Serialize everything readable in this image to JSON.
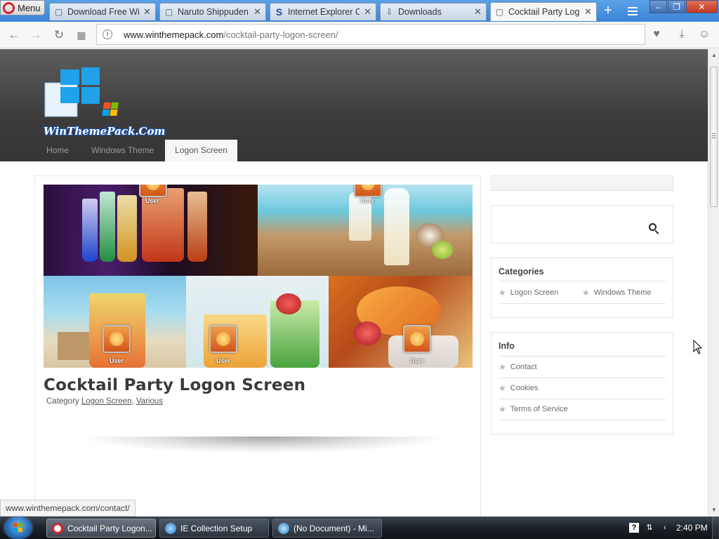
{
  "browser": {
    "menu_label": "Menu",
    "tabs": [
      {
        "title": "Download Free Windows",
        "icon": "page-icon"
      },
      {
        "title": "Naruto Shippuden",
        "icon": "page-icon"
      },
      {
        "title": "Internet Explorer Co",
        "icon": "s-logo-icon"
      },
      {
        "title": "Downloads",
        "icon": "download-icon"
      },
      {
        "title": "Cocktail Party Logon Screen",
        "icon": "page-icon",
        "active": true
      }
    ],
    "url_domain": "www.winthemepack.com",
    "url_path": "/cocktail-party-logon-screen/",
    "status_url": "www.winthemepack.com/contact/"
  },
  "site": {
    "logo_text": "WinThemePack.Com",
    "nav": [
      "Home",
      "Windows Theme",
      "Logon Screen"
    ],
    "nav_current": "Logon Screen"
  },
  "post": {
    "title": "Cocktail Party Logon Screen",
    "meta_prefix": "Category ",
    "categories": [
      "Logon Screen",
      "Various"
    ],
    "meta_sep": ", ",
    "tile_user_label": "User"
  },
  "sidebar": {
    "categories_title": "Categories",
    "categories": [
      "Logon Screen",
      "Windows Theme"
    ],
    "info_title": "Info",
    "info_links": [
      "Contact",
      "Cookies",
      "Terms of Service"
    ]
  },
  "taskbar": {
    "buttons": [
      {
        "label": "Cocktail Party Logon...",
        "icon": "opera-icon",
        "active": true
      },
      {
        "label": "IE Collection Setup",
        "icon": "globe-icon",
        "active": false
      },
      {
        "label": "(No Document) - Mi...",
        "icon": "globe-icon",
        "active": false
      }
    ],
    "clock": "2:40 PM"
  },
  "colors": {
    "tab_bar": "#3b84d6",
    "header_dark": "#3c3c3c",
    "opera_red": "#d2232a"
  }
}
